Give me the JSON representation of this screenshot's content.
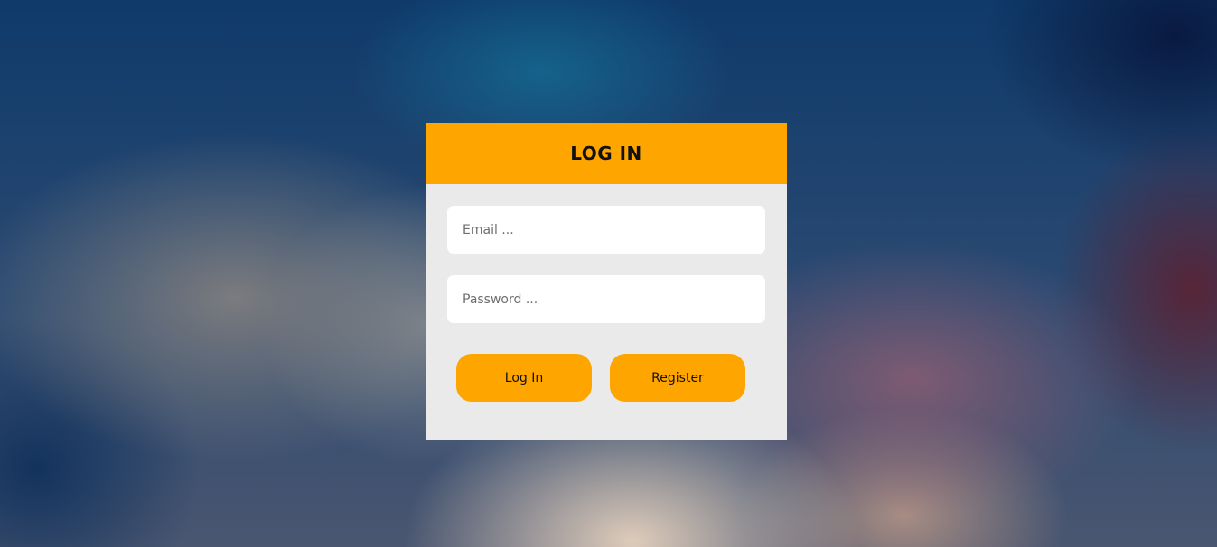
{
  "login_card": {
    "title": "LOG IN",
    "email_field": {
      "placeholder": "Email ...",
      "value": ""
    },
    "password_field": {
      "placeholder": "Password ...",
      "value": ""
    },
    "buttons": {
      "login_label": "Log In",
      "register_label": "Register"
    }
  },
  "colors": {
    "accent": "#ffa500",
    "card_background": "#eaeaea",
    "field_background": "#ffffff",
    "text": "#111111"
  }
}
